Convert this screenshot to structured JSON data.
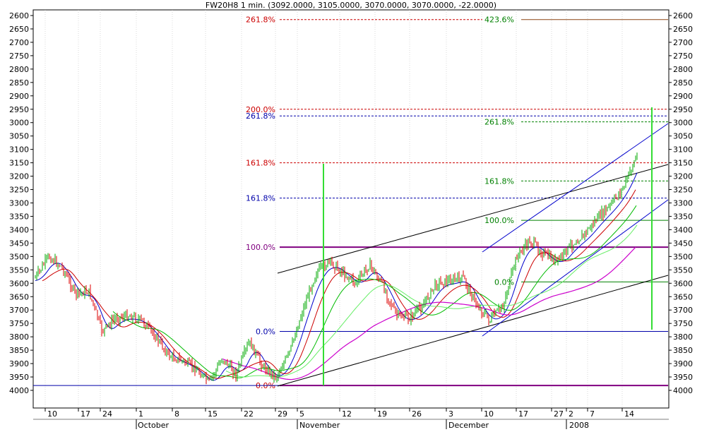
{
  "chart_data": {
    "type": "line",
    "subtype": "candlestick",
    "title": "FW20H8 1 min. (3092.0000, 3105.0000, 3070.0000, 3070.0000, -22.0000)",
    "y_axis": {
      "inverted": true,
      "ylim": [
        2600,
        4000
      ],
      "ticks": [
        2600,
        2650,
        2700,
        2750,
        2800,
        2850,
        2900,
        2950,
        3000,
        3050,
        3100,
        3150,
        3200,
        3250,
        3300,
        3350,
        3400,
        3450,
        3500,
        3550,
        3600,
        3650,
        3700,
        3750,
        3800,
        3850,
        3900,
        3950,
        4000
      ],
      "tick_labels": [
        "2600",
        "2650",
        "2700",
        "2750",
        "2800",
        "2850",
        "2900",
        "2950",
        "3000",
        "3050",
        "3100",
        "3150",
        "3200",
        "3250",
        "3300",
        "3350",
        "3400",
        "3450",
        "3500",
        "3550",
        "3600",
        "3650",
        "3700",
        "3750",
        "3800",
        "3850",
        "3900",
        "3950",
        "4000"
      ],
      "both_sides": true
    },
    "x_axis": {
      "tick_labels": [
        "10",
        "17",
        "24",
        "1",
        "8",
        "15",
        "22",
        "29",
        "5",
        "12",
        "19",
        "26",
        "3",
        "10",
        "17",
        "27",
        "2",
        "7",
        "14"
      ],
      "month_labels": [
        "October",
        "November",
        "December",
        "2008"
      ],
      "grid": true
    },
    "fibonacci_levels": [
      {
        "label": "261.8%",
        "value": 2615,
        "color": "#cc0000"
      },
      {
        "label": "423.6%",
        "value": 2615,
        "color": "#008000"
      },
      {
        "label": "200.0%",
        "value": 2950,
        "color": "#cc0000"
      },
      {
        "label": "261.8%",
        "value": 2975,
        "color": "#0000aa"
      },
      {
        "label": "261.8%",
        "value": 2997,
        "color": "#008000"
      },
      {
        "label": "161.8%",
        "value": 3150,
        "color": "#cc0000"
      },
      {
        "label": "161.8%",
        "value": 3218,
        "color": "#008000"
      },
      {
        "label": "161.8%",
        "value": 3282,
        "color": "#0000aa"
      },
      {
        "label": "100.0%",
        "value": 3365,
        "color": "#008000"
      },
      {
        "label": "100.0%",
        "value": 3465,
        "color": "#800080"
      },
      {
        "label": "0.0%",
        "value": 3595,
        "color": "#008000"
      },
      {
        "label": "0.0%",
        "value": 3780,
        "color": "#0000aa"
      },
      {
        "label": "0.0%",
        "value": 3982,
        "color": "#cc0000"
      }
    ],
    "colors": {
      "up_candle": "#00aa00",
      "down_candle": "#dd0000",
      "ma_blue": "#0000cc",
      "ma_red": "#cc0000",
      "ma_green": "#00bb00",
      "ma_green_light": "#66ee66",
      "ma_magenta": "#cc00cc",
      "vertical_marker": "#33dd33",
      "grid": "#c0c0c0"
    },
    "series": [
      {
        "name": "",
        "values": [
          3580,
          3500,
          3540,
          3640,
          3630,
          3780,
          3730,
          3720,
          3740,
          3800,
          3870,
          3890,
          3920,
          3970,
          3880,
          3940,
          3820,
          3910,
          3950,
          3860,
          3700,
          3560,
          3520,
          3560,
          3600,
          3530,
          3610,
          3720,
          3730,
          3680,
          3600,
          3590,
          3580,
          3680,
          3740,
          3680,
          3500,
          3440,
          3490,
          3520,
          3460,
          3420,
          3360,
          3310,
          3240,
          3120
        ]
      }
    ]
  }
}
